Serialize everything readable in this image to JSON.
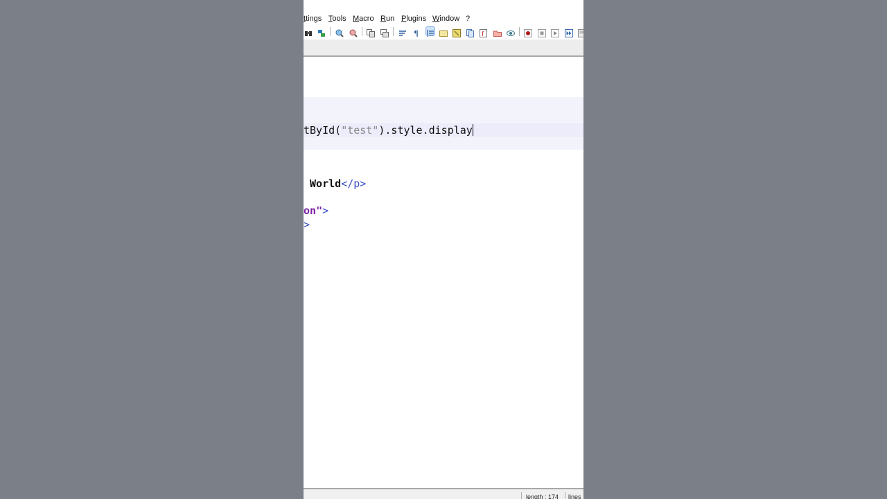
{
  "menu": [
    "ttings",
    "Tools",
    "Macro",
    "Run",
    "Plugins",
    "Window",
    "?"
  ],
  "toolbar_icons": [
    "binoculars-icon",
    "find-replace-icon",
    "zoom-in-icon",
    "zoom-out-icon",
    "sync-vertical-icon",
    "sync-horizontal-icon",
    "word-wrap-icon",
    "show-all-characters-icon",
    "indent-guide-icon",
    "user-language-icon",
    "doc-map-icon",
    "doc-list-icon",
    "function-list-icon",
    "folder-workspace-icon",
    "monitor-icon",
    "record-macro-icon",
    "stop-macro-icon",
    "play-macro-icon",
    "play-macro-multiple-icon",
    "save-macro-icon"
  ],
  "editor": {
    "line1": {
      "a": "tById(",
      "b": "\"test\"",
      "c": ").style.display"
    },
    "line2": {
      "pre": " ",
      "kw": "World",
      "tag": "</p>"
    },
    "line3": {
      "attr": "on",
      "q": "\"",
      "tag": ">"
    },
    "line4": {
      "tag": ">"
    }
  },
  "status": {
    "length": "length : 174",
    "lines": "lines"
  }
}
